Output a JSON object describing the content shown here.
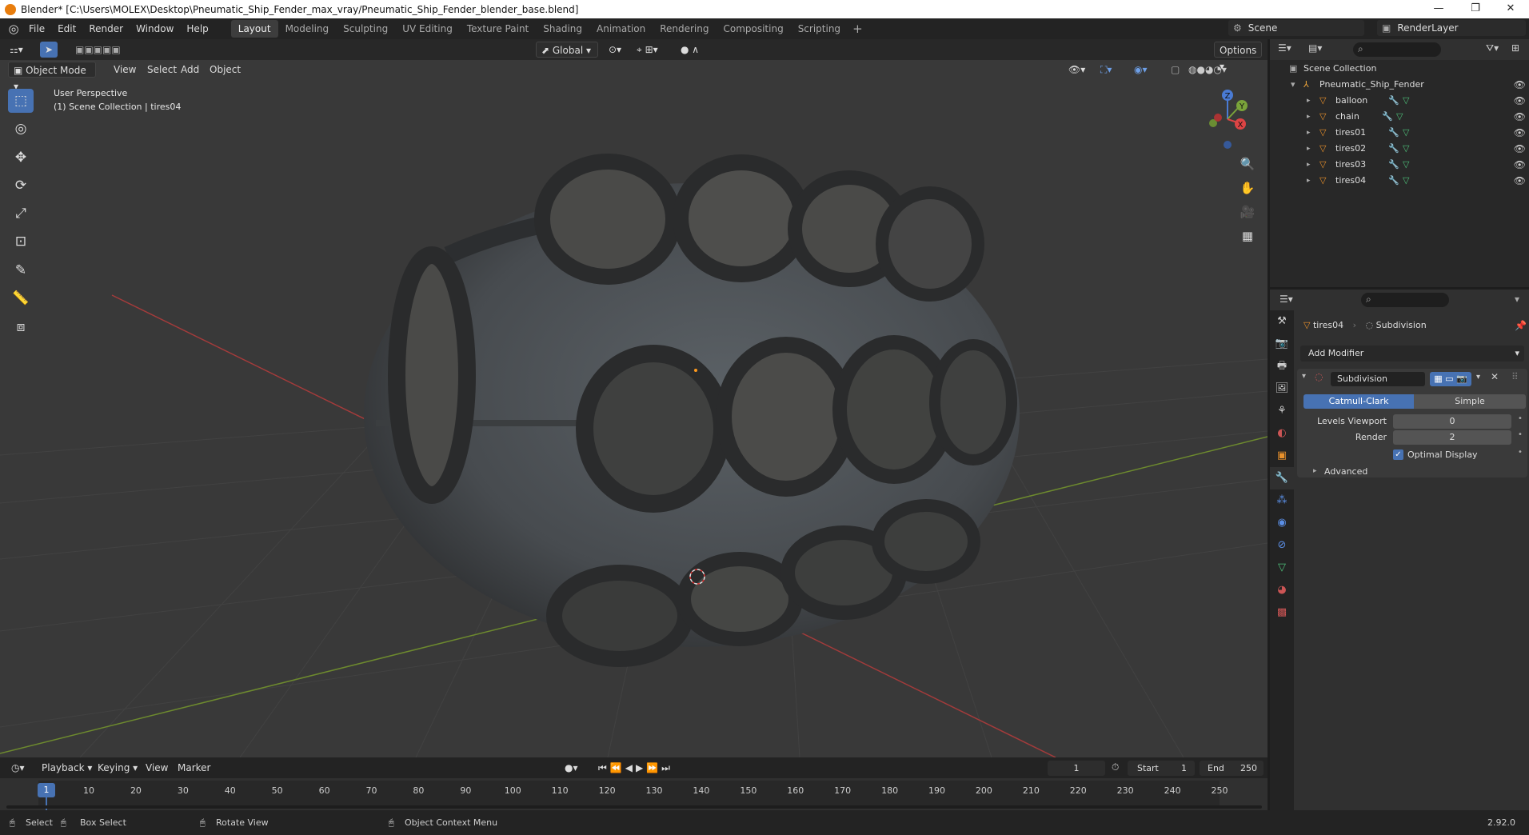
{
  "window": {
    "title": "Blender* [C:\\Users\\MOLEX\\Desktop\\Pneumatic_Ship_Fender_max_vray/Pneumatic_Ship_Fender_blender_base.blend]",
    "minimize": "—",
    "maximize": "❐",
    "close": "✕"
  },
  "menu": [
    "File",
    "Edit",
    "Render",
    "Window",
    "Help"
  ],
  "workspaces": [
    "Layout",
    "Modeling",
    "Sculpting",
    "UV Editing",
    "Texture Paint",
    "Shading",
    "Animation",
    "Rendering",
    "Compositing",
    "Scripting"
  ],
  "active_workspace": "Layout",
  "scene": {
    "label": "Scene",
    "render_layer": "RenderLayer"
  },
  "viewport": {
    "mode": "Object Mode",
    "menus": [
      "View",
      "Select",
      "Add",
      "Object"
    ],
    "transform_orientation": "Global",
    "options_label": "Options",
    "perspective": "User Perspective",
    "collection_info": "(1) Scene Collection | tires04",
    "gizmo_axes": {
      "x": "X",
      "y": "Y",
      "z": "Z"
    }
  },
  "outliner": {
    "root": "Scene Collection",
    "collection": "Pneumatic_Ship_Fender",
    "objects": [
      "balloon",
      "chain",
      "tires01",
      "tires02",
      "tires03",
      "tires04"
    ],
    "selected": "tires04"
  },
  "properties": {
    "object": "tires04",
    "modifier_name_header": "Subdivision",
    "add_modifier": "Add Modifier",
    "modifier": {
      "name": "Subdivision",
      "method_options": [
        "Catmull-Clark",
        "Simple"
      ],
      "method_active": "Catmull-Clark",
      "levels_viewport_label": "Levels Viewport",
      "levels_viewport": "0",
      "render_label": "Render",
      "render": "2",
      "optimal_display_label": "Optimal Display",
      "optimal_display": true,
      "advanced_label": "Advanced"
    }
  },
  "timeline": {
    "menus": [
      "Playback",
      "Keying",
      "View",
      "Marker"
    ],
    "current_frame": "1",
    "start_label": "Start",
    "start": "1",
    "end_label": "End",
    "end": "250",
    "ticks": [
      "1",
      "10",
      "20",
      "30",
      "40",
      "50",
      "60",
      "70",
      "80",
      "90",
      "100",
      "110",
      "120",
      "130",
      "140",
      "150",
      "160",
      "170",
      "180",
      "190",
      "200",
      "210",
      "220",
      "230",
      "240",
      "250"
    ]
  },
  "statusbar": {
    "select": "Select",
    "box_select": "Box Select",
    "rotate_view": "Rotate View",
    "context_menu": "Object Context Menu",
    "version": "2.92.0"
  }
}
